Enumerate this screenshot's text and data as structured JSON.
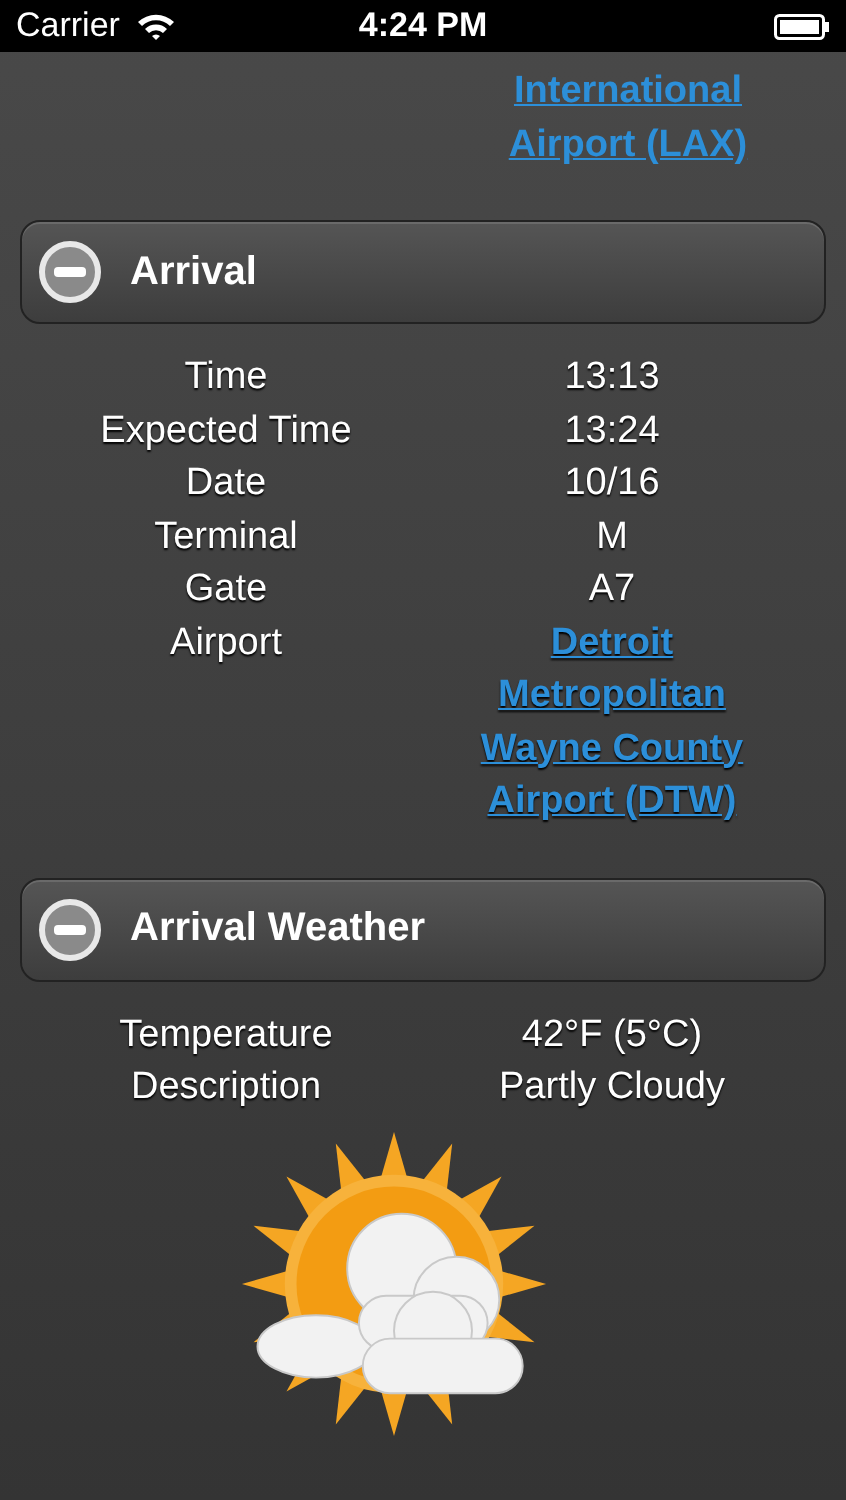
{
  "status_bar": {
    "carrier": "Carrier",
    "time": "4:24 PM"
  },
  "previous_fragment": {
    "value_lines": [
      "International",
      "Airport (LAX)"
    ]
  },
  "sections": [
    {
      "title": "Arrival",
      "expanded": true,
      "kind": "details",
      "rows": [
        {
          "label": "Time",
          "value_lines": [
            "13:13"
          ],
          "kind": "text"
        },
        {
          "label": "Expected Time",
          "value_lines": [
            "13:24"
          ],
          "kind": "text"
        },
        {
          "label": "Date",
          "value_lines": [
            "10/16"
          ],
          "kind": "text"
        },
        {
          "label": "Terminal",
          "value_lines": [
            "M"
          ],
          "kind": "text"
        },
        {
          "label": "Gate",
          "value_lines": [
            "A7"
          ],
          "kind": "text"
        },
        {
          "label": "Airport",
          "value_lines": [
            "Detroit",
            "Metropolitan",
            "Wayne County",
            "Airport (DTW)"
          ],
          "kind": "link"
        }
      ]
    },
    {
      "title": "Arrival Weather",
      "expanded": true,
      "kind": "weather",
      "rows": [
        {
          "label": "Temperature",
          "value_lines": [
            "42°F (5°C)"
          ],
          "kind": "text"
        },
        {
          "label": "Description",
          "value_lines": [
            "Partly Cloudy"
          ],
          "kind": "text"
        }
      ]
    }
  ]
}
